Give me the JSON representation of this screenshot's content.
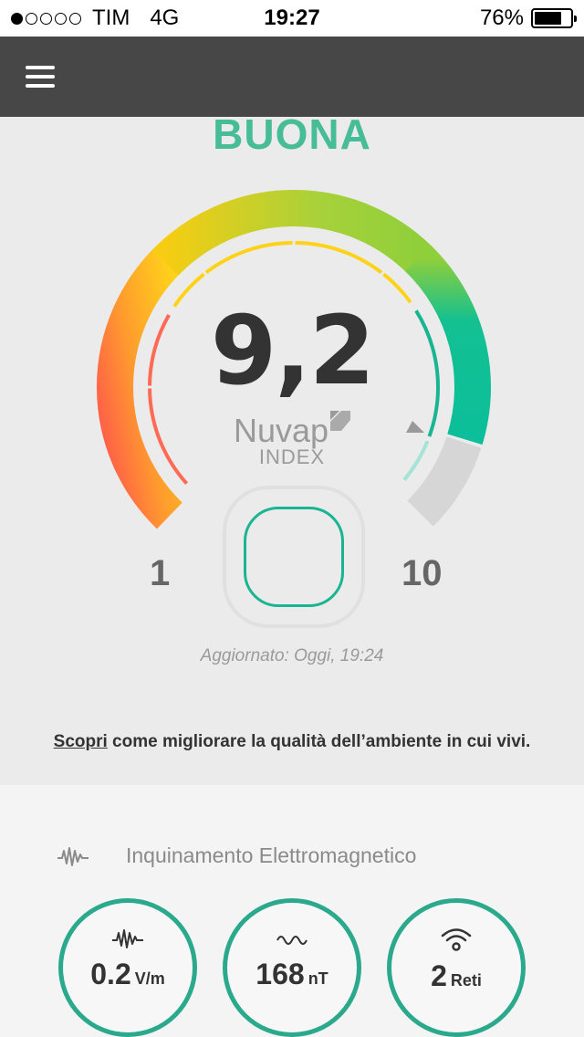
{
  "status_bar": {
    "carrier": "TIM",
    "network": "4G",
    "time": "19:27",
    "battery": "76%",
    "battery_level": 0.76,
    "signal_bars": 1
  },
  "nav": {
    "menu_icon": "hamburger-menu-icon"
  },
  "hero": {
    "quality_label": "BUONA",
    "score": "9,2",
    "brand_name": "Nuvap",
    "brand_sub": "INDEX",
    "range_min": "1",
    "range_max": "10",
    "updated": "Aggiornato: Oggi, 19:24",
    "discover_link": "Scopri",
    "discover_text": " come migliorare la qualità dell’ambiente in cui vivi.",
    "score_value": 9.2
  },
  "colors": {
    "accent": "#46bd96",
    "teal": "#2aa98c",
    "navbar": "#474747",
    "red": "#ff5a4a",
    "yellow": "#ffd21a",
    "green": "#8fcf3a"
  },
  "section": {
    "title": "Inquinamento Elettromagnetico",
    "icon": "emf-wave-icon",
    "cards": [
      {
        "value": "0.2",
        "unit": "V/m",
        "icon": "emf-wave-icon"
      },
      {
        "value": "168",
        "unit": "nT",
        "icon": "magnetic-wave-icon"
      },
      {
        "value": "2",
        "unit": "Reti",
        "icon": "wifi-icon"
      }
    ]
  }
}
